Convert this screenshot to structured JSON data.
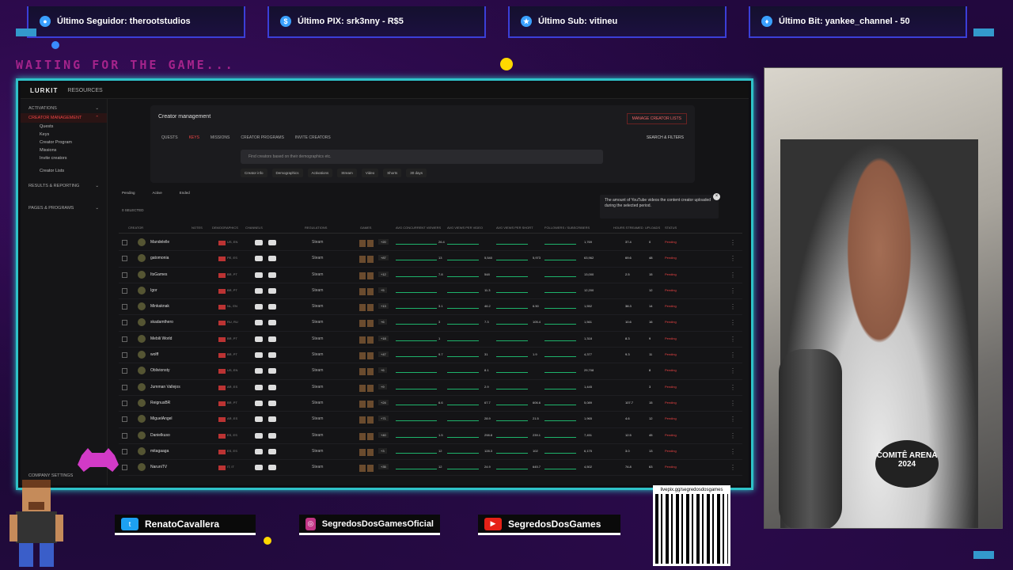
{
  "overlay": {
    "top_boxes": [
      {
        "label": "Último Seguidor: therootstudios",
        "icon": "user-icon"
      },
      {
        "label": "Último PIX: srk3nny - R$5",
        "icon": "dollar-icon"
      },
      {
        "label": "Último Sub: vitineu",
        "icon": "star-icon"
      },
      {
        "label": "Último Bit: yankee_channel - 50",
        "icon": "diamond-icon"
      }
    ],
    "waiting": "WAITING FOR THE GAME...",
    "socials": [
      {
        "label": "RenatoCavallera",
        "icon": "twitter-icon",
        "color": "#1da1f2"
      },
      {
        "label": "SegredosDosGamesOficial",
        "icon": "instagram-icon",
        "color": "#c13584"
      },
      {
        "label": "SegredosDosGames",
        "icon": "youtube-icon",
        "color": "#e62117"
      }
    ],
    "qr_url": "livepix.gg/segredosdosgames",
    "shirt_text": "COMITÊ ARENA 2024"
  },
  "app": {
    "logo": "LURKIT",
    "resources": "RESOURCES",
    "sidebar": [
      {
        "label": "ACTIVATIONS"
      },
      {
        "label": "CREATOR MANAGEMENT",
        "selected": true
      },
      {
        "label": "Quests",
        "sub": true
      },
      {
        "label": "Keys",
        "sub": true
      },
      {
        "label": "Creator Program",
        "sub": true
      },
      {
        "label": "Missions",
        "sub": true
      },
      {
        "label": "Invite creators",
        "sub": true
      },
      {
        "label": "Creator Lists",
        "sub": true
      },
      {
        "label": "RESULTS & REPORTING"
      },
      {
        "label": "PAGES & PROGRAMS"
      }
    ],
    "footer": "COMPANY SETTINGS",
    "header_title": "Creator management",
    "manage_lists": "MANAGE CREATOR LISTS",
    "tabs": [
      "QUESTS",
      "KEYS",
      "MISSIONS",
      "CREATOR PROGRAMS",
      "INVITE CREATORS"
    ],
    "search_filters": "SEARCH & FILTERS",
    "search_placeholder": "Find creators based on their demographics etc.",
    "chips": [
      "Creator info",
      "Demographics",
      "Activations",
      "Stream",
      "Video",
      "Shorts",
      "30 days"
    ],
    "subtabs": [
      "Pending",
      "Active",
      "Ended"
    ],
    "selected": "0 SELECTED",
    "tooltip": "The amount of YouTube videos the content creator uploaded during the selected period.",
    "columns": [
      "CREATOR",
      "NOTES",
      "DEMOGRAPHICS",
      "CHANNELS",
      "REGULATIONS",
      "GAMES",
      "AVG CONCURRENT VIEWERS",
      "AVG VIEWS PER VIDEO",
      "AVG VIEWS PER SHORT",
      "FOLLOWERS / SUBSCRIBERS",
      "HOURS STREAMED",
      "UPLOADS",
      "STATUS"
    ],
    "rows": [
      {
        "name": "Mandelelle",
        "country": "US, EN",
        "platform": "Steam",
        "games": "+20",
        "v1": "26.4",
        "v4": "1,769",
        "h": "37.4",
        "u": "0"
      },
      {
        "name": "gatomonia",
        "country": "PE, ES",
        "platform": "Steam",
        "games": "+87",
        "v1": "13",
        "v2": "5,540",
        "v3": "5,973",
        "v4": "63,962",
        "h": "69.6",
        "u": "48"
      },
      {
        "name": "ItsGames",
        "country": "BR, PT",
        "platform": "Steam",
        "games": "+12",
        "v1": "7.8",
        "v2": "548",
        "v4": "13,000",
        "h": "2.5",
        "u": "15"
      },
      {
        "name": "Igor",
        "country": "BR, PT",
        "platform": "Steam",
        "games": "+5",
        "v2": "11.3",
        "v4": "12,200",
        "h": "",
        "u": "12"
      },
      {
        "name": "Minkaknak",
        "country": "NL, EN",
        "platform": "Steam",
        "games": "+13",
        "v1": "3.1",
        "v2": "46.2",
        "v3": "6.50",
        "v4": "1,552",
        "h": "38.3",
        "u": "14"
      },
      {
        "name": "skadamthero",
        "country": "RU, RU",
        "platform": "Steam",
        "games": "+6",
        "v1": "3",
        "v2": "7.3",
        "v3": "105.4",
        "v4": "1,561",
        "h": "10.6",
        "u": "16"
      },
      {
        "name": "Mebili World",
        "country": "BR, PT",
        "platform": "Steam",
        "games": "+18",
        "v1": "1",
        "v4": "1,318",
        "h": "8.3",
        "u": "9"
      },
      {
        "name": "wolff",
        "country": "BR, PT",
        "platform": "Steam",
        "games": "+47",
        "v1": "9.7",
        "v2": "31",
        "v3": "1.9",
        "v4": "4,377",
        "h": "9.3",
        "u": "11"
      },
      {
        "name": "Oblivionsty",
        "country": "US, EN",
        "platform": "Steam",
        "games": "+6",
        "v2": "8.1",
        "v4": "29,708",
        "h": "",
        "u": "8"
      },
      {
        "name": "Jumman Vallejos",
        "country": "AR, ES",
        "platform": "Steam",
        "games": "+9",
        "v2": "2.9",
        "v4": "1,445",
        "h": "",
        "u": "3"
      },
      {
        "name": "ReignusBR",
        "country": "BR, PT",
        "platform": "Steam",
        "games": "+24",
        "v1": "6.6",
        "v2": "67.7",
        "v3": "606.6",
        "v4": "5,089",
        "h": "107.7",
        "u": "15"
      },
      {
        "name": "MiguelAngel",
        "country": "AR, ES",
        "platform": "Steam",
        "games": "+71",
        "v2": "28.9",
        "v3": "21.5",
        "v4": "1,965",
        "h": "4.6",
        "u": "12"
      },
      {
        "name": "Danielkuso",
        "country": "ES, ES",
        "platform": "Steam",
        "games": "+40",
        "v1": "1.5",
        "v2": "298.8",
        "v3": "239.1",
        "v4": "7,451",
        "h": "12.5",
        "u": "45"
      },
      {
        "name": "mitagaaga",
        "country": "ES, ES",
        "platform": "Steam",
        "games": "+3",
        "v1": "12",
        "v2": "128.3",
        "v3": "102",
        "v4": "6,175",
        "h": "3.0",
        "u": "13"
      },
      {
        "name": "NaruniTV",
        "country": "IT, IT",
        "platform": "Steam",
        "games": "+35",
        "v1": "12",
        "v2": "24.9",
        "v3": "645.7",
        "v4": "4,502",
        "h": "74.8",
        "u": "63"
      }
    ],
    "status": "Pending"
  }
}
